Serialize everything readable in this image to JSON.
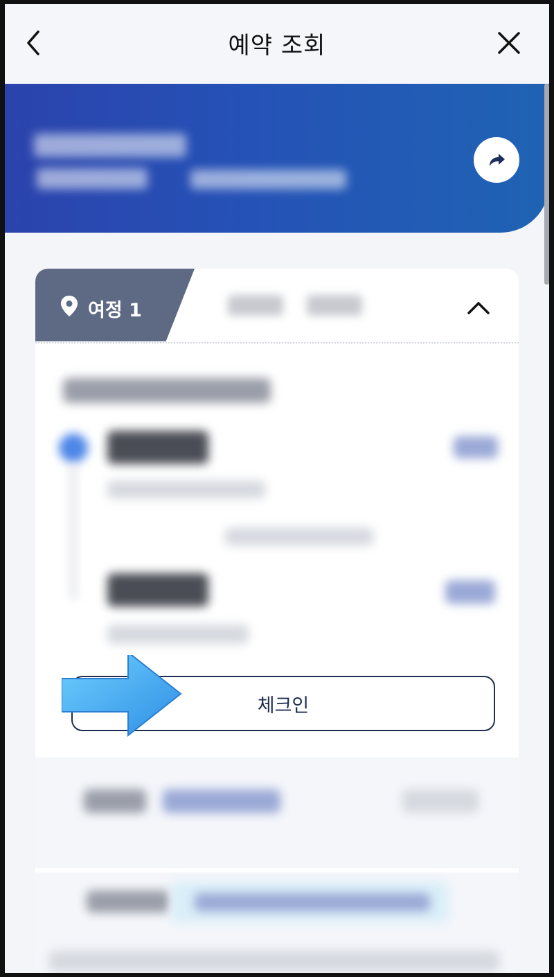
{
  "header": {
    "title": "예약 조회",
    "back_icon": "chevron-left-icon",
    "close_icon": "close-icon"
  },
  "banner": {
    "gradient_start": "#2b43ad",
    "gradient_end": "#1f63b4",
    "share_icon": "share-arrow-icon"
  },
  "journey": {
    "tab_label": "여정 1",
    "tab_color": "#5e6a84",
    "pin_icon": "location-pin-icon",
    "collapse_icon": "chevron-up-icon"
  },
  "actions": {
    "checkin_label": "체크인"
  },
  "annotation": {
    "arrow_color": "#3aa6f0"
  }
}
